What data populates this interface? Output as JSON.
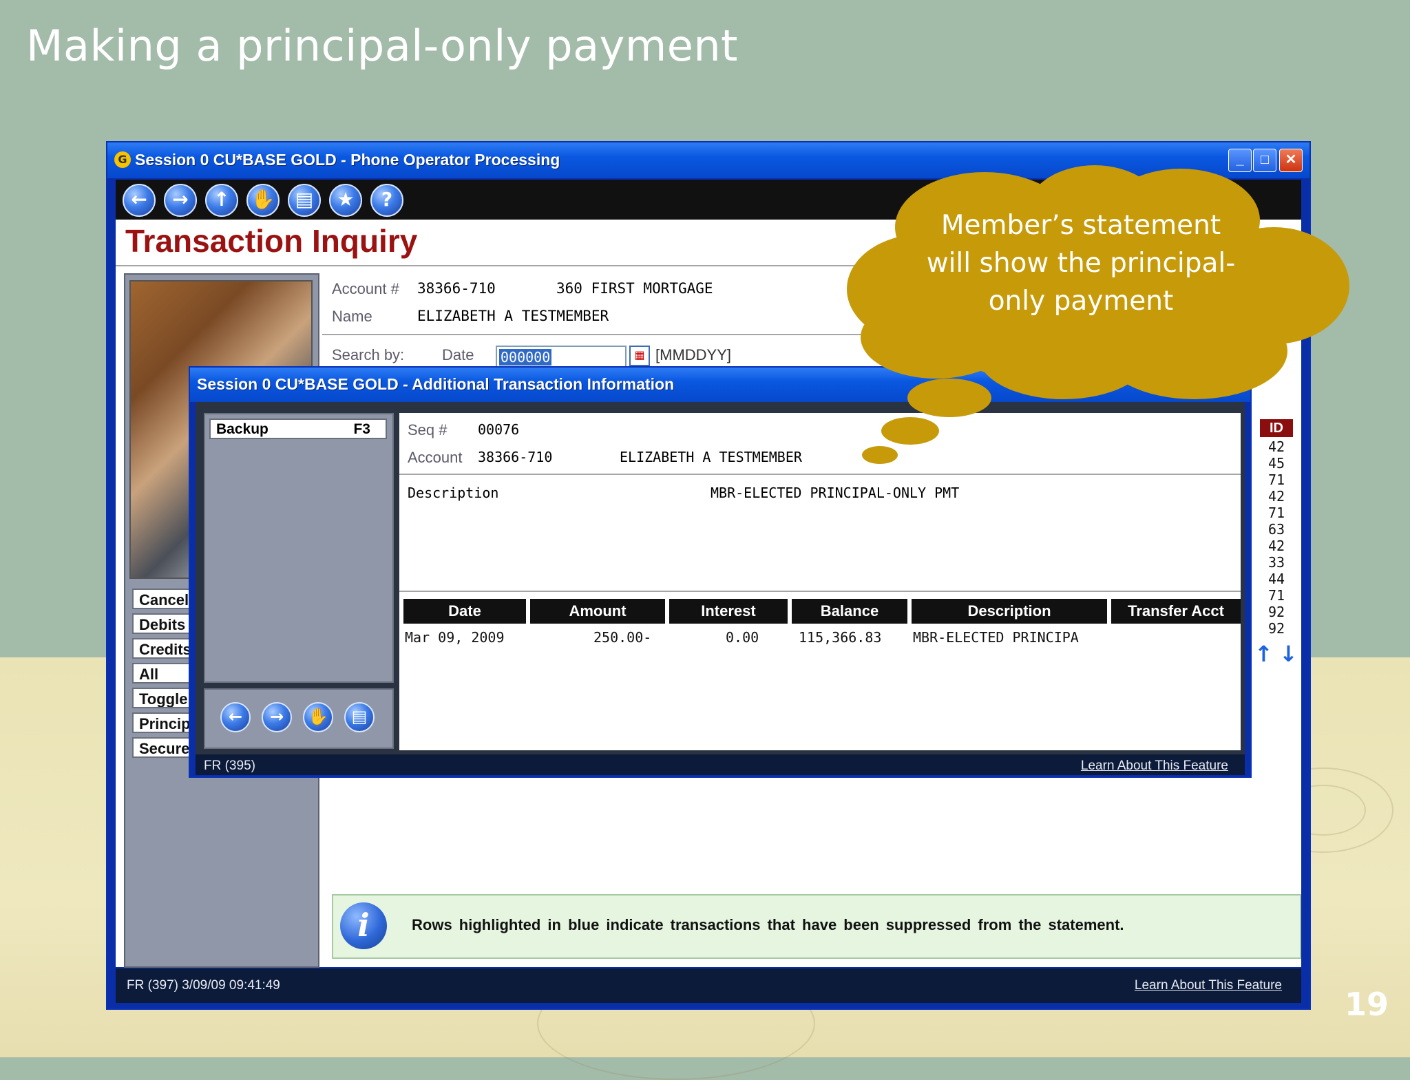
{
  "slide": {
    "title": "Making a principal-only payment",
    "page_number": "19"
  },
  "main_window": {
    "title": "Session 0 CU*BASE GOLD - Phone Operator Processing",
    "page_title": "Transaction Inquiry",
    "account_label": "Account #",
    "account_value": "38366-710",
    "account_desc": "360 FIRST MORTGAGE",
    "name_label": "Name",
    "name_value": "ELIZABETH A TESTMEMBER",
    "search_label": "Search by:",
    "date_label": "Date",
    "date_value": "000000",
    "date_format": "[MMDDYY]",
    "side_buttons": [
      "Cancel",
      "Debits",
      "Credits",
      "All",
      "Toggle",
      "Princip",
      "Secure"
    ],
    "id_header": "ID",
    "id_values": [
      "42",
      "45",
      "71",
      "42",
      "71",
      "63",
      "42",
      "33",
      "44",
      "71",
      "92",
      "92"
    ],
    "info_text": "Rows highlighted in blue indicate transactions that have been suppressed from the statement.",
    "status_left": "FR (397) 3/09/09 09:41:49",
    "status_right": "Learn About This Feature"
  },
  "dialog": {
    "title": "Session 0 CU*BASE GOLD - Additional Transaction Information",
    "backup_label": "Backup",
    "backup_key": "F3",
    "seq_label": "Seq #",
    "seq_value": "00076",
    "account_label": "Account",
    "account_value": "38366-710",
    "account_name": "ELIZABETH A TESTMEMBER",
    "description_label": "Description",
    "description_value": "MBR-ELECTED PRINCIPAL-ONLY PMT",
    "columns": [
      "Date",
      "Amount",
      "Interest",
      "Balance",
      "Description",
      "Transfer Acct"
    ],
    "row": {
      "date": "Mar 09, 2009",
      "amount": "250.00-",
      "interest": "0.00",
      "balance": "115,366.83",
      "description": "MBR-ELECTED PRINCIPA",
      "transfer_acct": ""
    },
    "status_left": "FR (395)",
    "status_right": "Learn About This Feature"
  },
  "callout": {
    "text_line1": "Member’s statement",
    "text_line2": "will show the principal-",
    "text_line3": "only payment",
    "color": "#c79a0a"
  },
  "icons": {
    "toolbar": [
      "back-arrow-icon",
      "forward-arrow-icon",
      "up-arrow-icon",
      "hand-stop-icon",
      "print-icon",
      "star-icon",
      "help-icon"
    ],
    "dialog_nav": [
      "back-arrow-icon",
      "forward-arrow-icon",
      "hand-stop-icon",
      "print-icon"
    ]
  },
  "colors": {
    "title_bar": "#0a58e0",
    "page_title": "#9a1212",
    "info_bg": "#e6f5e0",
    "slide_bg": "#a3bba9"
  }
}
